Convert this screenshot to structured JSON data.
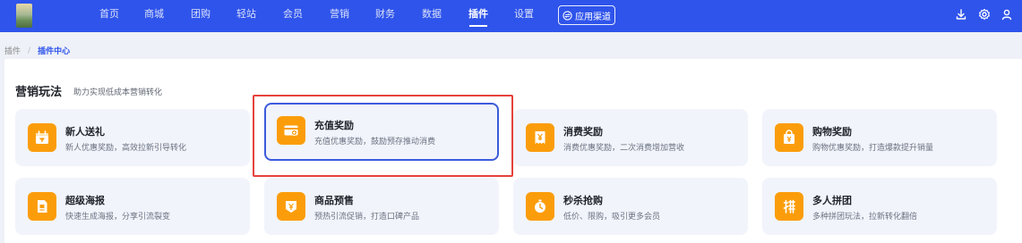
{
  "nav": {
    "items": [
      "首页",
      "商城",
      "团购",
      "轻站",
      "会员",
      "营销",
      "财务",
      "数据",
      "插件",
      "设置"
    ],
    "active": "插件",
    "channel_button": "应用渠道"
  },
  "breadcrumb": {
    "root": "插件",
    "separator": "/",
    "current": "插件中心"
  },
  "section": {
    "title": "营销玩法",
    "subtitle": "助力实现低成本营销转化"
  },
  "cards": [
    {
      "name": "新人送礼",
      "desc": "新人优惠奖励，高效拉新引导转化",
      "icon": "gift-calendar-icon"
    },
    {
      "name": "充值奖励",
      "desc": "充值优惠奖励，鼓励预存推动消费",
      "icon": "recharge-card-icon"
    },
    {
      "name": "消费奖励",
      "desc": "消费优惠奖励，二次消费增加营收",
      "icon": "yuan-receipt-icon"
    },
    {
      "name": "购物奖励",
      "desc": "购物优惠奖励，打造爆款提升销量",
      "icon": "shopping-bag-icon"
    },
    {
      "name": "超级海报",
      "desc": "快速生成海报，分享引流裂变",
      "icon": "poster-icon"
    },
    {
      "name": "商品预售",
      "desc": "预热引流促销，打造口碑产品",
      "icon": "presale-icon"
    },
    {
      "name": "秒杀抢购",
      "desc": "低价、限购，吸引更多会员",
      "icon": "stopwatch-icon"
    },
    {
      "name": "多人拼团",
      "desc": "多种拼团玩法，拉新转化翻倍",
      "icon": "group-buy-icon"
    }
  ],
  "colors": {
    "nav_bg": "#2f54eb",
    "icon_bg": "#fb9d0b",
    "card_bg": "#f1f4fb",
    "highlight_border": "#3b5bdb",
    "annotation_red": "#e5423b"
  }
}
